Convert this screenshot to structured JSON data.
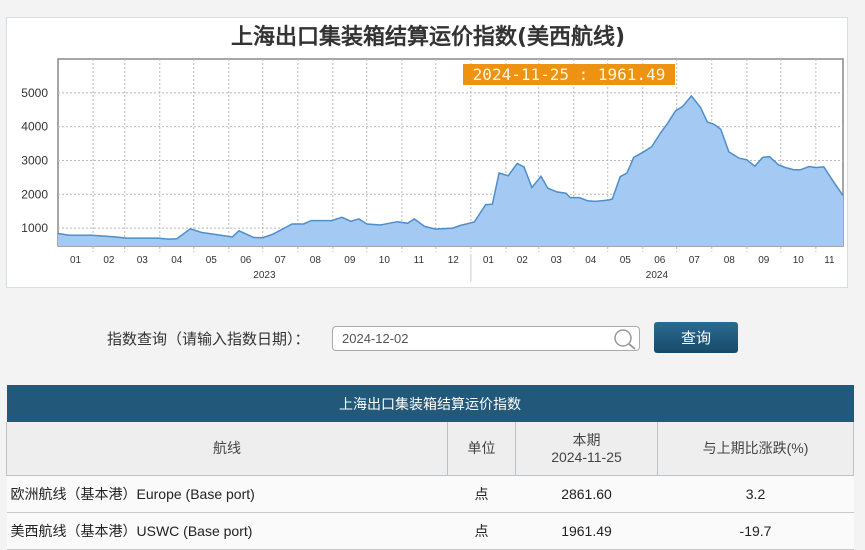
{
  "chart_data": {
    "type": "area",
    "title": "上海出口集装箱结算运价指数(美西航线)",
    "tooltip": "2024-11-25 : 1961.49",
    "ylim": [
      470,
      6000
    ],
    "yticks": [
      1000,
      2000,
      3000,
      4000,
      5000
    ],
    "xlim": [
      "2023-01-01",
      "2024-11-25"
    ],
    "month_labels": [
      "01",
      "02",
      "03",
      "04",
      "05",
      "06",
      "07",
      "08",
      "09",
      "10",
      "11",
      "12",
      "01",
      "02",
      "03",
      "04",
      "05",
      "06",
      "07",
      "08",
      "09",
      "10",
      "11"
    ],
    "year_labels": [
      "2023",
      "2024"
    ],
    "grid": true,
    "colors": {
      "fill": "#a4c9f2",
      "line": "#4d8ecb",
      "tooltip_bg": "#ee9214",
      "tooltip_text": "#fff6d8"
    },
    "points": [
      [
        "2023-01-01",
        840
      ],
      [
        "2023-01-11",
        790
      ],
      [
        "2023-01-31",
        790
      ],
      [
        "2023-02-19",
        745
      ],
      [
        "2023-03-03",
        705
      ],
      [
        "2023-03-30",
        705
      ],
      [
        "2023-04-09",
        675
      ],
      [
        "2023-04-16",
        685
      ],
      [
        "2023-04-28",
        980
      ],
      [
        "2023-05-08",
        870
      ],
      [
        "2023-05-25",
        790
      ],
      [
        "2023-06-04",
        735
      ],
      [
        "2023-06-10",
        920
      ],
      [
        "2023-06-23",
        720
      ],
      [
        "2023-07-01",
        715
      ],
      [
        "2023-07-10",
        820
      ],
      [
        "2023-07-27",
        1120
      ],
      [
        "2023-08-06",
        1120
      ],
      [
        "2023-08-13",
        1220
      ],
      [
        "2023-08-31",
        1220
      ],
      [
        "2023-09-09",
        1320
      ],
      [
        "2023-09-17",
        1200
      ],
      [
        "2023-09-24",
        1270
      ],
      [
        "2023-10-01",
        1120
      ],
      [
        "2023-10-13",
        1090
      ],
      [
        "2023-10-28",
        1190
      ],
      [
        "2023-11-06",
        1140
      ],
      [
        "2023-11-12",
        1270
      ],
      [
        "2023-11-21",
        1050
      ],
      [
        "2023-12-01",
        970
      ],
      [
        "2023-12-16",
        1000
      ],
      [
        "2023-12-23",
        1080
      ],
      [
        "2024-01-04",
        1180
      ],
      [
        "2024-01-14",
        1690
      ],
      [
        "2024-01-20",
        1710
      ],
      [
        "2024-01-26",
        2630
      ],
      [
        "2024-02-03",
        2550
      ],
      [
        "2024-02-11",
        2910
      ],
      [
        "2024-02-17",
        2810
      ],
      [
        "2024-02-24",
        2200
      ],
      [
        "2024-03-03",
        2530
      ],
      [
        "2024-03-09",
        2180
      ],
      [
        "2024-03-17",
        2070
      ],
      [
        "2024-03-25",
        2030
      ],
      [
        "2024-03-29",
        1900
      ],
      [
        "2024-04-06",
        1900
      ],
      [
        "2024-04-13",
        1810
      ],
      [
        "2024-04-20",
        1790
      ],
      [
        "2024-05-02",
        1830
      ],
      [
        "2024-05-05",
        1860
      ],
      [
        "2024-05-12",
        2520
      ],
      [
        "2024-05-18",
        2630
      ],
      [
        "2024-05-24",
        3090
      ],
      [
        "2024-06-01",
        3240
      ],
      [
        "2024-06-09",
        3410
      ],
      [
        "2024-06-17",
        3830
      ],
      [
        "2024-06-23",
        4100
      ],
      [
        "2024-06-30",
        4470
      ],
      [
        "2024-07-06",
        4590
      ],
      [
        "2024-07-14",
        4910
      ],
      [
        "2024-07-22",
        4570
      ],
      [
        "2024-07-28",
        4140
      ],
      [
        "2024-08-03",
        4070
      ],
      [
        "2024-08-09",
        3920
      ],
      [
        "2024-08-16",
        3260
      ],
      [
        "2024-08-25",
        3070
      ],
      [
        "2024-09-01",
        3020
      ],
      [
        "2024-09-08",
        2830
      ],
      [
        "2024-09-15",
        3090
      ],
      [
        "2024-09-21",
        3110
      ],
      [
        "2024-09-29",
        2870
      ],
      [
        "2024-10-05",
        2790
      ],
      [
        "2024-10-12",
        2730
      ],
      [
        "2024-10-18",
        2720
      ],
      [
        "2024-10-26",
        2820
      ],
      [
        "2024-11-01",
        2790
      ],
      [
        "2024-11-08",
        2810
      ],
      [
        "2024-11-16",
        2400
      ],
      [
        "2024-11-25",
        1961.49
      ]
    ]
  },
  "query": {
    "label": "指数查询（请输入指数日期）：",
    "input_value": "2024-12-02",
    "button_label": "查询"
  },
  "table": {
    "caption": "上海出口集装箱结算运价指数",
    "headers": {
      "route": "航线",
      "unit": "单位",
      "period": "本期",
      "period_date": "2024-11-25",
      "change": "与上期比涨跌(%)"
    },
    "rows": [
      {
        "route": "欧洲航线（基本港）Europe (Base port)",
        "unit": "点",
        "value": "2861.60",
        "change": "3.2"
      },
      {
        "route": "美西航线（基本港）USWC (Base port)",
        "unit": "点",
        "value": "1961.49",
        "change": "-19.7"
      }
    ]
  }
}
